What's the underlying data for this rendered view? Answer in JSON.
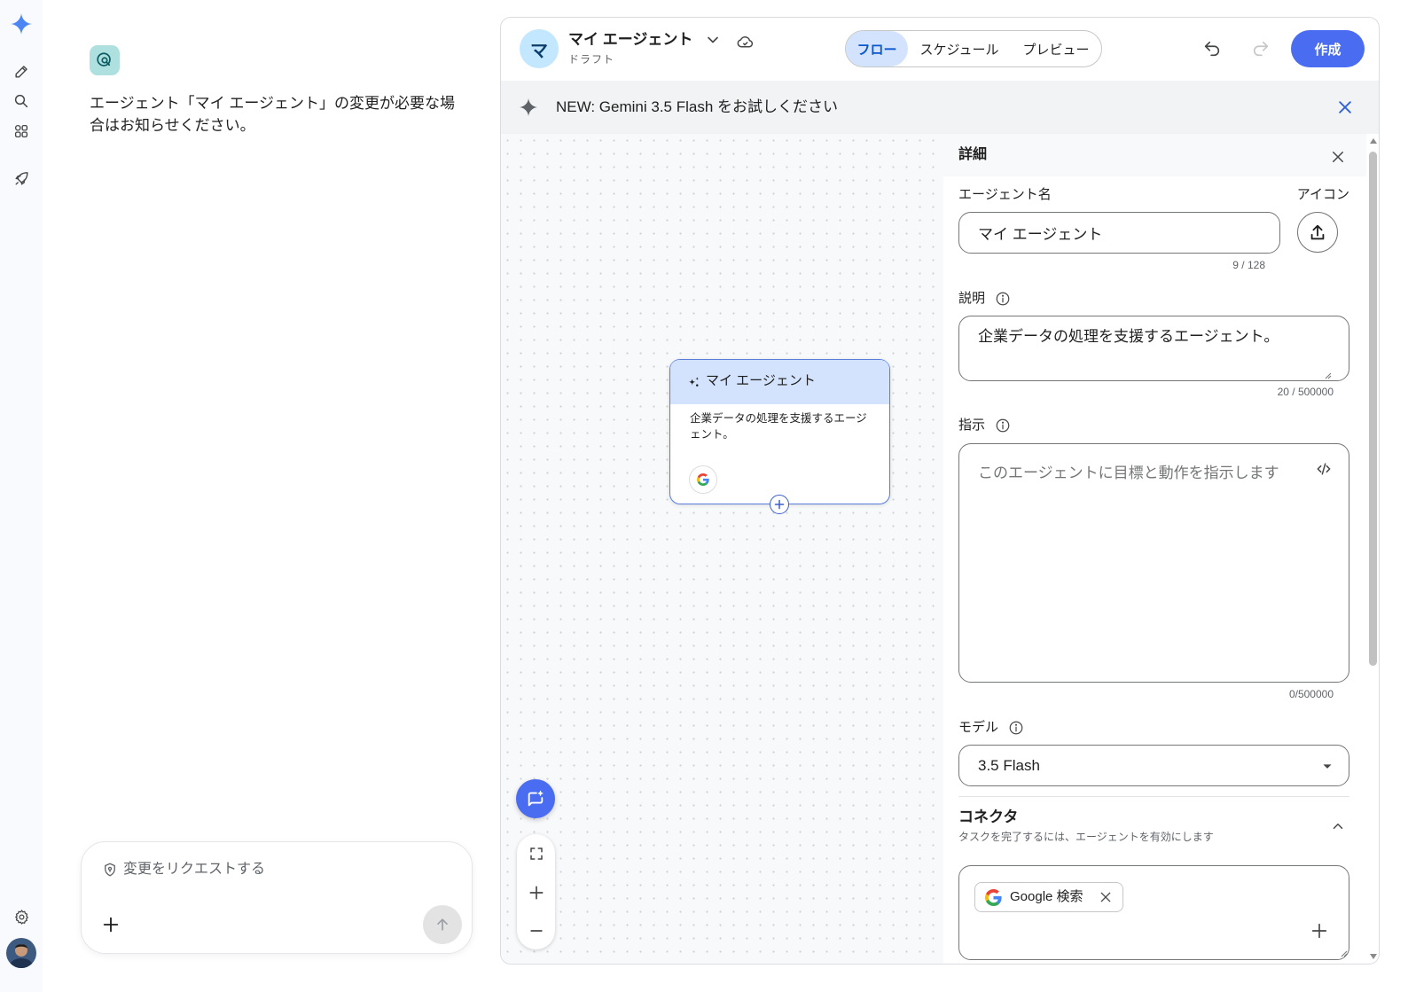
{
  "theme": {
    "accent": "#4a6cf0",
    "selected_tab_bg": "#d3e3fd",
    "selected_tab_text": "#0b57d0",
    "banner_bg": "#f1f3f4",
    "banner_close": "#2f62d6",
    "node_header_bg": "#d3e3fd",
    "node_border": "#5a7ddc",
    "badge_bg": "#aee0df"
  },
  "rail": {
    "top_icons": [
      "gemini-logo-icon",
      "new-chat-icon",
      "search-icon",
      "apps-icon",
      "rocket-icon"
    ],
    "bottom_icons": [
      "settings-icon",
      "user-avatar"
    ]
  },
  "chat": {
    "badge_icon": "agent-icon",
    "message": "エージェント「マイ エージェント」の変更が必要な場合はお知らせください。",
    "composer": {
      "placeholder": "変更をリクエストする",
      "placeholder_icon": "shield-icon",
      "attach_icon": "plus-icon",
      "send_icon": "arrow-up-icon"
    }
  },
  "header": {
    "avatar_letter": "マ",
    "title": "マイ エージェント",
    "status": "ドラフト",
    "tabs": [
      {
        "label": "フロー",
        "selected": true
      },
      {
        "label": "スケジュール",
        "selected": false
      },
      {
        "label": "プレビュー",
        "selected": false
      }
    ],
    "undo_icon": "undo-icon",
    "redo_icon": "redo-icon",
    "create_label": "作成"
  },
  "banner": {
    "icon": "sparkle-icon",
    "text": "NEW: Gemini 3.5 Flash をお試しください"
  },
  "canvas": {
    "node": {
      "title": "マイ エージェント",
      "description": "企業データの処理を支援するエージェント。",
      "tools": [
        "google-icon"
      ]
    },
    "controls": [
      "fit-view-icon",
      "zoom-in-icon",
      "zoom-out-icon"
    ]
  },
  "details": {
    "title": "詳細",
    "name": {
      "label": "エージェント名",
      "value": "マイ エージェント",
      "counter": "9 / 128"
    },
    "icon": {
      "label": "アイコン"
    },
    "description": {
      "label": "説明",
      "value": "企業データの処理を支援するエージェント。",
      "counter": "20 / 500000"
    },
    "instructions": {
      "label": "指示",
      "placeholder": "このエージェントに目標と動作を指示します",
      "counter": "0/500000"
    },
    "model": {
      "label": "モデル",
      "value": "3.5 Flash"
    },
    "connectors": {
      "title": "コネクタ",
      "subtitle": "タスクを完了するには、エージェントを有効にします",
      "items": [
        {
          "label": "Google 検索",
          "icon": "google-icon"
        }
      ]
    }
  }
}
